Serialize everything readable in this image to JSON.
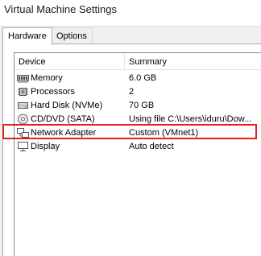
{
  "window": {
    "title": "Virtual Machine Settings"
  },
  "tabs": [
    {
      "label": "Hardware",
      "selected": true
    },
    {
      "label": "Options",
      "selected": false
    }
  ],
  "device_list": {
    "columns": [
      "Device",
      "Summary"
    ],
    "rows": [
      {
        "device": "Memory",
        "summary": "6.0 GB",
        "icon": "memory-icon"
      },
      {
        "device": "Processors",
        "summary": "2",
        "icon": "processor-icon"
      },
      {
        "device": "Hard Disk (NVMe)",
        "summary": "70 GB",
        "icon": "hard-disk-icon"
      },
      {
        "device": "CD/DVD (SATA)",
        "summary": "Using file C:\\Users\\iduru\\Dow...",
        "icon": "cd-dvd-icon"
      },
      {
        "device": "Network Adapter",
        "summary": "Custom (VMnet1)",
        "icon": "network-adapter-icon",
        "highlighted": true
      },
      {
        "device": "Display",
        "summary": "Auto detect",
        "icon": "display-icon"
      }
    ]
  },
  "colors": {
    "highlight_border": "#e0201f",
    "selection": "#cce8ff"
  }
}
